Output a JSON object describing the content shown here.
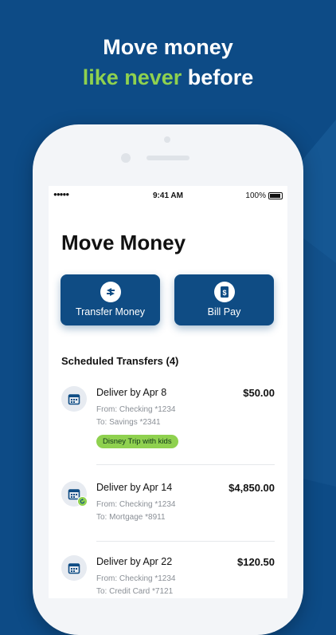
{
  "headline": {
    "line1": "Move money",
    "line2_highlight": "like never",
    "line2_rest": " before"
  },
  "colors": {
    "background": "#0d4b86",
    "accent": "#8fd14f",
    "button": "#0f4c84"
  },
  "status_bar": {
    "signal": "●●●●●",
    "time": "9:41 AM",
    "battery": "100%"
  },
  "screen": {
    "title": "Move Money",
    "actions": [
      {
        "label": "Transfer Money",
        "icon": "transfer-arrows-icon"
      },
      {
        "label": "Bill Pay",
        "icon": "bill-icon"
      }
    ],
    "section_title": "Scheduled Transfers (4)",
    "transfers": [
      {
        "deliver": "Deliver by Apr 8",
        "amount": "$50.00",
        "from": "From: Checking *1234",
        "to": "To: Savings *2341",
        "tag": "Disney Trip with kids",
        "recurring": false
      },
      {
        "deliver": "Deliver by Apr 14",
        "amount": "$4,850.00",
        "from": "From: Checking *1234",
        "to": "To: Mortgage *8911",
        "tag": "",
        "recurring": true
      },
      {
        "deliver": "Deliver by Apr 22",
        "amount": "$120.50",
        "from": "From: Checking *1234",
        "to": "To: Credit Card *7121",
        "tag": "",
        "recurring": false
      }
    ]
  }
}
